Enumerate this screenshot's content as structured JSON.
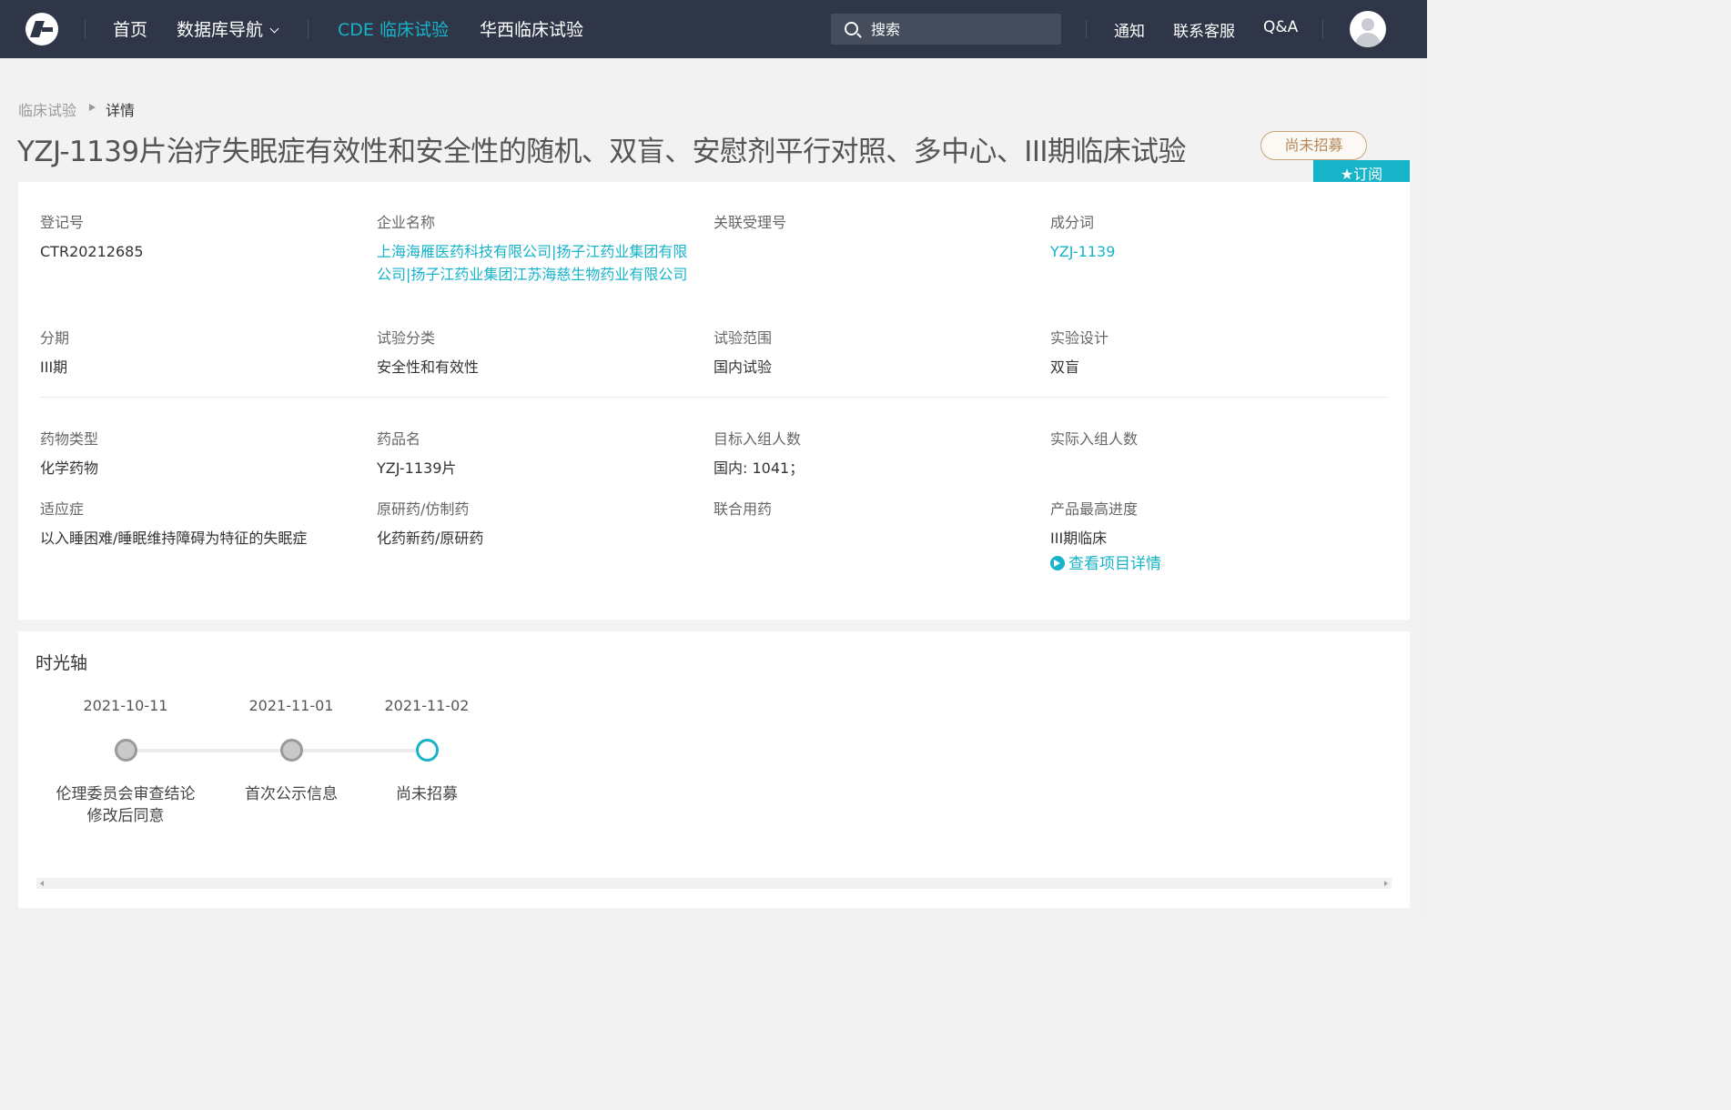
{
  "nav": {
    "items": [
      "首页",
      "数据库导航",
      "CDE 临床试验",
      "华西临床试验"
    ],
    "active_index": 2,
    "search_placeholder": "搜索",
    "right_links": [
      "通知",
      "联系客服",
      "Q&A"
    ]
  },
  "breadcrumb": [
    "临床试验",
    "详情"
  ],
  "title": "YZJ-1139片治疗失眠症有效性和安全性的随机、双盲、安慰剂平行对照、多中心、III期临床试验",
  "status_tag": "尚未招募",
  "subscribe_label": "★订阅",
  "info": {
    "reg_no": {
      "label": "登记号",
      "value": "CTR20212685"
    },
    "company": {
      "label": "企业名称",
      "value": "上海海雁医药科技有限公司|扬子江药业集团有限公司|扬子江药业集团江苏海慈生物药业有限公司"
    },
    "related_no": {
      "label": "关联受理号",
      "value": ""
    },
    "ingredient": {
      "label": "成分词",
      "value": "YZJ-1139"
    },
    "phase": {
      "label": "分期",
      "value": "III期"
    },
    "trial_type": {
      "label": "试验分类",
      "value": "安全性和有效性"
    },
    "scope": {
      "label": "试验范围",
      "value": "国内试验"
    },
    "design": {
      "label": "实验设计",
      "value": "双盲"
    },
    "drug_type": {
      "label": "药物类型",
      "value": "化学药物"
    },
    "drug_name": {
      "label": "药品名",
      "value": "YZJ-1139片"
    },
    "target_enroll": {
      "label": "目标入组人数",
      "value": "国内: 1041；"
    },
    "actual_enroll": {
      "label": "实际入组人数",
      "value": ""
    },
    "indication": {
      "label": "适应症",
      "value": "以入睡困难/睡眠维持障碍为特征的失眠症"
    },
    "originality": {
      "label": "原研药/仿制药",
      "value": "化药新药/原研药"
    },
    "combination": {
      "label": "联合用药",
      "value": ""
    },
    "max_progress": {
      "label": "产品最高进度",
      "value": "III期临床",
      "link": "查看项目详情"
    }
  },
  "timeline": {
    "title": "时光轴",
    "events": [
      {
        "date": "2021-10-11",
        "label": "伦理委员会审查结论修改后同意"
      },
      {
        "date": "2021-11-01",
        "label": "首次公示信息"
      },
      {
        "date": "2021-11-02",
        "label": "尚未招募"
      }
    ]
  },
  "colors": {
    "nav_bg": "#2f3647",
    "accent": "#17b3c9",
    "tag": "#b3895c"
  }
}
